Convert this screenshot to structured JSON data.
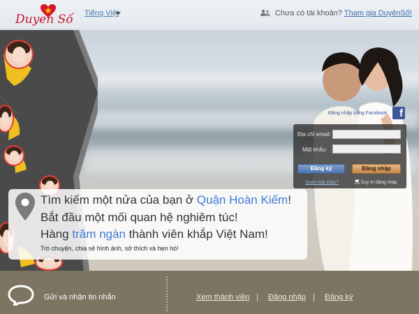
{
  "header": {
    "logo_text": "Duyen Số",
    "language": "Tiếng Việt",
    "account_question": "Chưa có tài khoản?",
    "join_link": "Tham gia DuyênSố!"
  },
  "login": {
    "facebook_text": "Đăng nhập bằng Facebook",
    "email_label": "Địa chỉ email:",
    "email_value": "",
    "password_label": "Mật khẩu:",
    "password_value": "",
    "register_button": "Đăng ký",
    "login_button": "Đăng nhập",
    "forgot_link": "Quên mật khẩu?",
    "remember_label": "Duy trì đăng nhập",
    "remember_checked": true
  },
  "tagline": {
    "line1_prefix": "Tìm kiếm một nửa của bạn ở ",
    "line1_highlight": "Quận Hoàn Kiếm",
    "line1_suffix": "!",
    "line2": "Bắt đầu một mối quan hệ nghiêm túc!",
    "line3_prefix": "Hàng ",
    "line3_highlight": "trăm ngàn",
    "line3_suffix": " thành viên khắp Việt Nam!",
    "line4": "Trò chuyện, chia sẻ hình ảnh, sở thích và hẹn hò!"
  },
  "footer": {
    "message": "Gửi và nhận tin nhắn",
    "links": [
      "Xem thành viên",
      "Đăng nhập",
      "Đăng ký"
    ],
    "separator": "|"
  },
  "colors": {
    "brand_red": "#c8102e",
    "link_blue": "#3d6fb0",
    "highlight_blue": "#3f7bd6",
    "footer_bg": "#7d7462"
  }
}
